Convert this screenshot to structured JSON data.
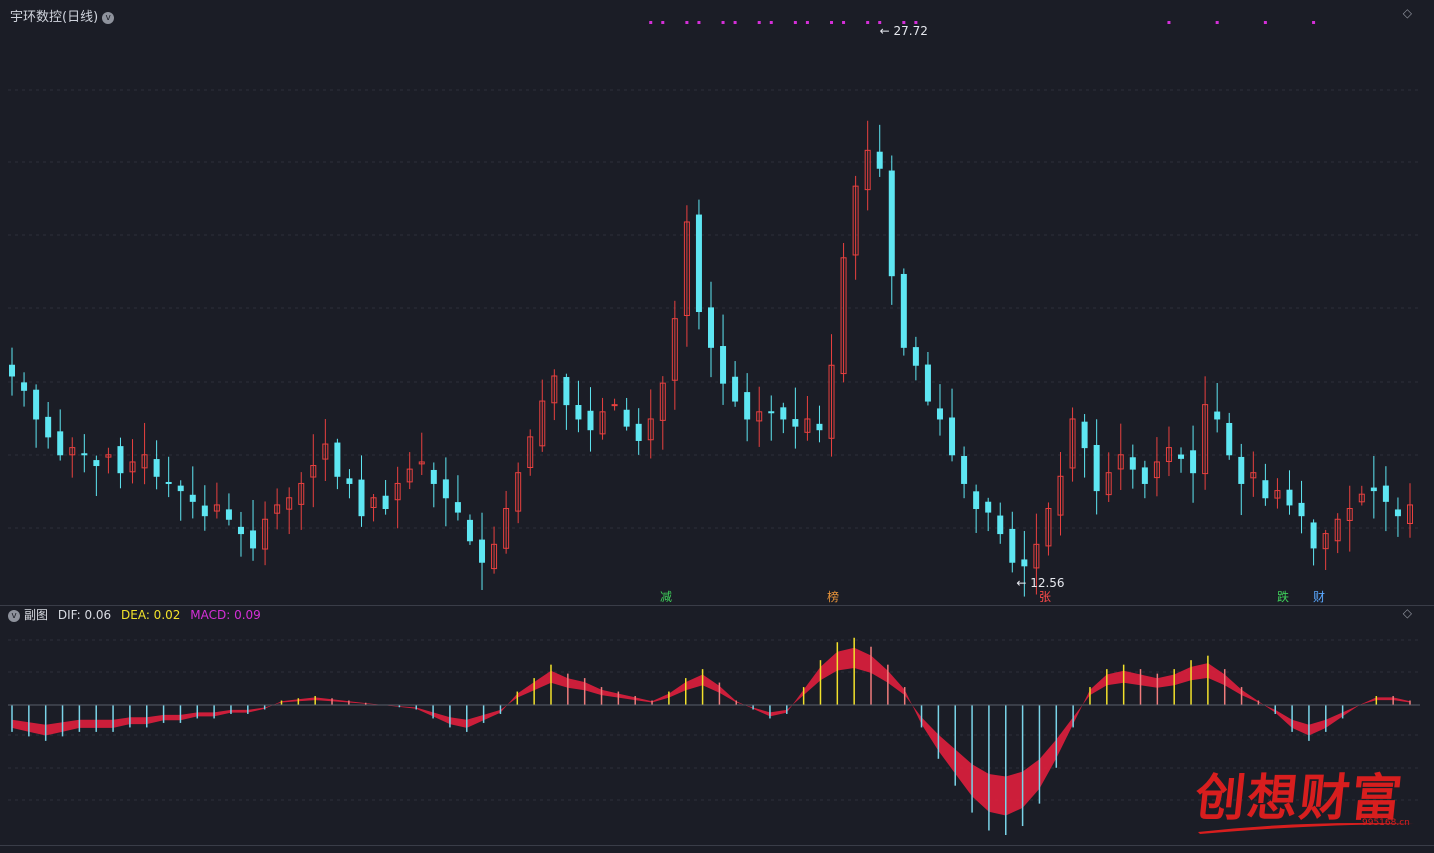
{
  "header": {
    "stock_name": "宇环数控(日线)"
  },
  "sub": {
    "title": "副图",
    "dif_label": "DIF: 0.06",
    "dea_label": "DEA: 0.02",
    "macd_label": "MACD: 0.09"
  },
  "annotations": {
    "high_label": "27.72",
    "low_label": "12.56"
  },
  "flags": [
    {
      "text": "减",
      "color": "#3fd05a"
    },
    {
      "text": "榜",
      "color": "#e8943a"
    },
    {
      "text": "张",
      "color": "#ff4a4a"
    },
    {
      "text": "跌",
      "color": "#3fd05a"
    },
    {
      "text": "财",
      "color": "#5aa8ff"
    }
  ],
  "watermark": {
    "text": "创想财富",
    "url": "995168.cn"
  },
  "colors": {
    "up": "#e8403f",
    "down": "#5ee6f2",
    "dot": "#d42fd8",
    "dif_fill_up": "#e01f3d",
    "dif_fill_down": "#1fd84a",
    "bg": "#1b1d26"
  },
  "chart_data": {
    "type": "candlestick",
    "high": 27.72,
    "low": 12.56,
    "price_series": [
      18.2,
      17.8,
      17.0,
      16.5,
      16.0,
      16.2,
      16.0,
      15.7,
      16.0,
      15.5,
      15.8,
      16.0,
      15.4,
      15.2,
      15.0,
      14.7,
      14.3,
      14.6,
      14.2,
      13.8,
      13.4,
      14.2,
      14.6,
      14.8,
      15.2,
      15.7,
      16.3,
      15.4,
      15.2,
      14.3,
      14.8,
      14.5,
      15.2,
      15.6,
      15.8,
      15.2,
      14.8,
      14.4,
      13.6,
      13.0,
      13.5,
      14.5,
      15.5,
      16.5,
      17.5,
      18.2,
      17.4,
      17.0,
      16.7,
      17.2,
      17.4,
      16.8,
      16.4,
      17.0,
      18.0,
      19.8,
      22.5,
      20.0,
      19.0,
      18.0,
      17.5,
      17.0,
      17.2,
      17.2,
      17.0,
      16.8,
      17.0,
      16.7,
      18.5,
      21.5,
      23.5,
      24.5,
      24.0,
      21.0,
      19.0,
      18.5,
      17.5,
      17.0,
      16.0,
      15.2,
      14.5,
      14.4,
      13.8,
      13.0,
      12.9,
      13.5,
      14.5,
      15.4,
      17.0,
      16.2,
      15.0,
      15.5,
      16.0,
      15.6,
      15.2,
      15.8,
      16.2,
      15.9,
      15.5,
      17.4,
      17.0,
      16.0,
      15.2,
      15.5,
      14.8,
      15.0,
      14.6,
      14.3,
      13.4,
      13.8,
      14.2,
      14.5,
      14.9,
      15.0,
      14.7,
      14.3,
      14.6
    ],
    "macd_hist": [
      -0.6,
      -0.7,
      -0.8,
      -0.7,
      -0.6,
      -0.6,
      -0.6,
      -0.5,
      -0.5,
      -0.4,
      -0.4,
      -0.3,
      -0.3,
      -0.2,
      -0.2,
      -0.1,
      0.1,
      0.15,
      0.2,
      0.15,
      0.1,
      0.05,
      0.0,
      -0.05,
      -0.1,
      -0.3,
      -0.5,
      -0.6,
      -0.4,
      -0.2,
      0.3,
      0.6,
      0.9,
      0.7,
      0.6,
      0.4,
      0.3,
      0.2,
      0.1,
      0.3,
      0.6,
      0.8,
      0.5,
      0.1,
      -0.1,
      -0.3,
      -0.2,
      0.4,
      1.0,
      1.4,
      1.5,
      1.3,
      0.9,
      0.4,
      -0.5,
      -1.2,
      -1.8,
      -2.4,
      -2.8,
      -2.9,
      -2.7,
      -2.2,
      -1.4,
      -0.5,
      0.4,
      0.8,
      0.9,
      0.8,
      0.7,
      0.8,
      1.0,
      1.1,
      0.8,
      0.4,
      0.1,
      -0.2,
      -0.6,
      -0.8,
      -0.6,
      -0.3,
      0.0,
      0.2,
      0.2,
      0.1
    ]
  }
}
